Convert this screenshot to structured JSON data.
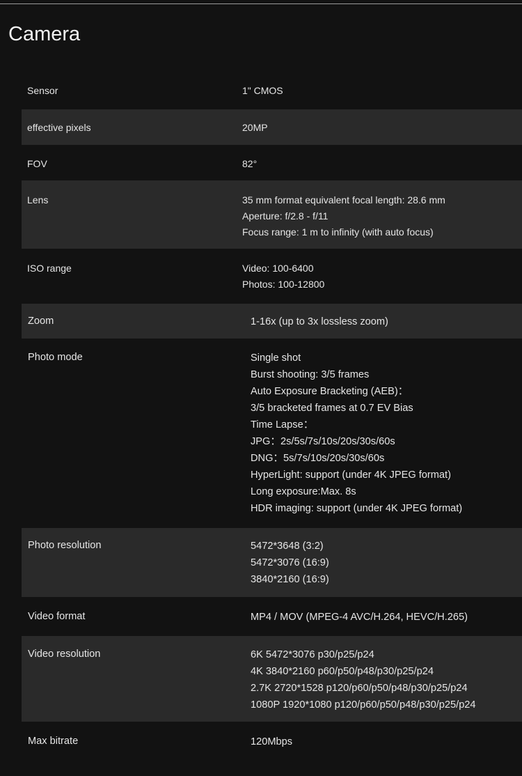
{
  "page": {
    "title": "Camera"
  },
  "specs": [
    {
      "label": "Sensor",
      "lines": [
        "1\" CMOS"
      ]
    },
    {
      "label": "effective pixels",
      "lines": [
        "20MP"
      ]
    },
    {
      "label": "FOV",
      "lines": [
        "82°"
      ]
    },
    {
      "label": "Lens",
      "lines": [
        "35 mm format equivalent focal length: 28.6 mm",
        "Aperture: f/2.8 - f/11",
        "Focus range: 1 m to infinity (with auto focus)"
      ]
    },
    {
      "label": "ISO range",
      "lines": [
        "Video: 100-6400",
        "Photos: 100-12800"
      ]
    },
    {
      "label": "Zoom",
      "lines": [
        "1-16x (up to 3x lossless zoom)"
      ]
    },
    {
      "label": "Photo mode",
      "lines": [
        "Single shot",
        "Burst shooting: 3/5 frames",
        "Auto Exposure Bracketing (AEB)：",
        "3/5 bracketed frames at 0.7 EV Bias",
        "Time Lapse：",
        "JPG：2s/5s/7s/10s/20s/30s/60s",
        "DNG：5s/7s/10s/20s/30s/60s",
        "HyperLight: support (under 4K JPEG format)",
        "Long exposure:Max. 8s",
        "HDR imaging: support (under 4K JPEG format)"
      ]
    },
    {
      "label": "Photo resolution",
      "lines": [
        "5472*3648 (3:2)",
        "5472*3076 (16:9)",
        "3840*2160 (16:9)"
      ]
    },
    {
      "label": "Video format",
      "lines": [
        "MP4 / MOV (MPEG-4 AVC/H.264, HEVC/H.265)"
      ]
    },
    {
      "label": "Video resolution",
      "lines": [
        "6K 5472*3076 p30/p25/p24",
        "4K 3840*2160 p60/p50/p48/p30/p25/p24",
        "2.7K 2720*1528 p120/p60/p50/p48/p30/p25/p24",
        "1080P 1920*1080 p120/p60/p50/p48/p30/p25/p24"
      ]
    },
    {
      "label": "Max bitrate",
      "lines": [
        "120Mbps"
      ]
    }
  ]
}
